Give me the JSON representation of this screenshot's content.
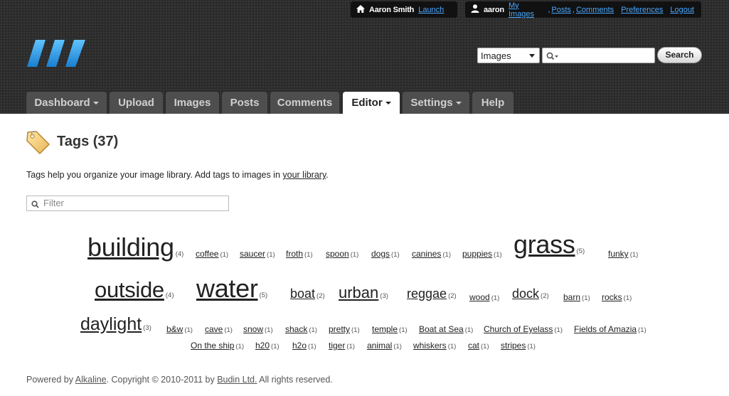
{
  "userbar": {
    "display_name": "Aaron Smith",
    "launch": "Launch",
    "username": "aaron",
    "links": [
      {
        "label": "My Images"
      },
      {
        "label": "Posts"
      },
      {
        "label": "Comments"
      }
    ],
    "preferences": "Preferences",
    "logout": "Logout",
    "separator": ","
  },
  "search": {
    "scope": "Images",
    "query": "",
    "button": "Search"
  },
  "tabs": [
    {
      "label": "Dashboard",
      "dropdown": true
    },
    {
      "label": "Upload",
      "dropdown": false
    },
    {
      "label": "Images",
      "dropdown": false
    },
    {
      "label": "Posts",
      "dropdown": false
    },
    {
      "label": "Comments",
      "dropdown": false
    },
    {
      "label": "Editor",
      "dropdown": true,
      "active": true
    },
    {
      "label": "Settings",
      "dropdown": true
    },
    {
      "label": "Help",
      "dropdown": false
    }
  ],
  "page": {
    "title": "Tags (37)",
    "intro_prefix": "Tags help you organize your image library. Add tags to images in ",
    "intro_link": "your library",
    "intro_suffix": ".",
    "filter_placeholder": "Filter"
  },
  "tags": [
    {
      "name": "building",
      "count": "(4)"
    },
    {
      "name": "coffee",
      "count": "(1)"
    },
    {
      "name": "saucer",
      "count": "(1)"
    },
    {
      "name": "froth",
      "count": "(1)"
    },
    {
      "name": "spoon",
      "count": "(1)"
    },
    {
      "name": "dogs",
      "count": "(1)"
    },
    {
      "name": "canines",
      "count": "(1)"
    },
    {
      "name": "puppies",
      "count": "(1)"
    },
    {
      "name": "grass",
      "count": "(5)"
    },
    {
      "name": "funky",
      "count": "(1)"
    },
    {
      "name": "outside",
      "count": "(4)"
    },
    {
      "name": "water",
      "count": "(5)"
    },
    {
      "name": "boat",
      "count": "(2)"
    },
    {
      "name": "urban",
      "count": "(3)"
    },
    {
      "name": "reggae",
      "count": "(2)"
    },
    {
      "name": "wood",
      "count": "(1)"
    },
    {
      "name": "dock",
      "count": "(2)"
    },
    {
      "name": "barn",
      "count": "(1)"
    },
    {
      "name": "rocks",
      "count": "(1)"
    },
    {
      "name": "daylight",
      "count": "(3)"
    },
    {
      "name": "b&w",
      "count": "(1)"
    },
    {
      "name": "cave",
      "count": "(1)"
    },
    {
      "name": "snow",
      "count": "(1)"
    },
    {
      "name": "shack",
      "count": "(1)"
    },
    {
      "name": "pretty",
      "count": "(1)"
    },
    {
      "name": "temple",
      "count": "(1)"
    },
    {
      "name": "Boat at Sea",
      "count": "(1)"
    },
    {
      "name": "Church of Eyelass",
      "count": "(1)"
    },
    {
      "name": "Fields of Amazia",
      "count": "(1)"
    },
    {
      "name": "On the ship",
      "count": "(1)"
    },
    {
      "name": "h20",
      "count": "(1)"
    },
    {
      "name": "h2o",
      "count": "(1)"
    },
    {
      "name": "tiger",
      "count": "(1)"
    },
    {
      "name": "animal",
      "count": "(1)"
    },
    {
      "name": "whiskers",
      "count": "(1)"
    },
    {
      "name": "cat",
      "count": "(1)"
    },
    {
      "name": "stripes",
      "count": "(1)"
    }
  ],
  "footer": {
    "prefix": "Powered by ",
    "brand": "Alkaline",
    "middle": ". Copyright © 2010-2011 by ",
    "company": "Budin Ltd.",
    "suffix": " All rights reserved."
  },
  "colors": {
    "header_bg": "#2b2b2b",
    "link_blue": "#4aa8ff",
    "tab_bg": "#4e4e4e",
    "logo_blue": "#2e9de8"
  },
  "icons": [
    "home-icon",
    "user-icon",
    "logo-icon",
    "search-icon",
    "tag-icon",
    "caret-down-icon"
  ]
}
